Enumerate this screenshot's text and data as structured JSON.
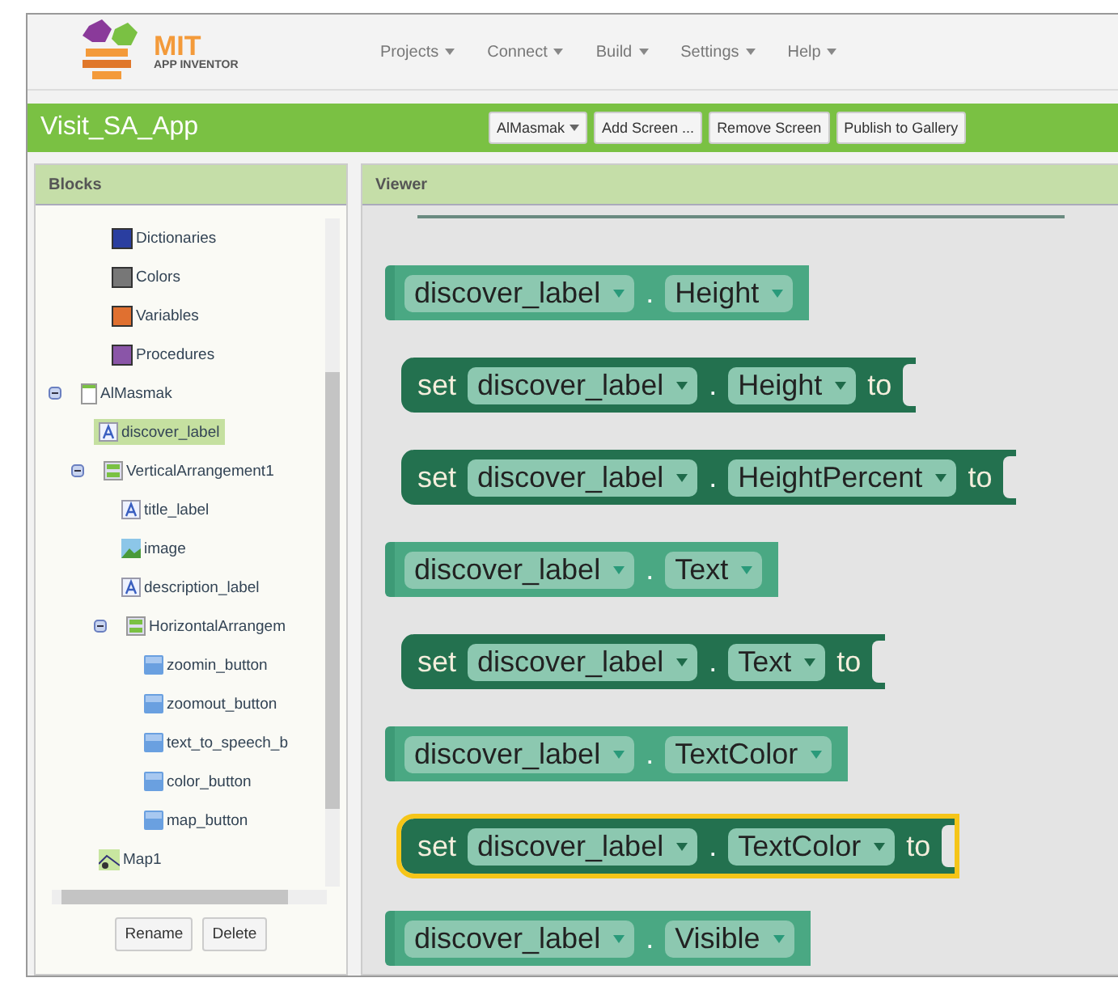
{
  "header": {
    "logo": {
      "title": "MIT",
      "subtitle": "APP INVENTOR"
    },
    "menus": [
      {
        "label": "Projects"
      },
      {
        "label": "Connect"
      },
      {
        "label": "Build"
      },
      {
        "label": "Settings"
      },
      {
        "label": "Help"
      }
    ]
  },
  "project_bar": {
    "title": "Visit_SA_App",
    "buttons": [
      {
        "label": "AlMasmak",
        "kind": "dropdown"
      },
      {
        "label": "Add Screen ...",
        "kind": "plain"
      },
      {
        "label": "Remove Screen",
        "kind": "plain"
      },
      {
        "label": "Publish to Gallery",
        "kind": "plain"
      }
    ]
  },
  "blocks_panel": {
    "title": "Blocks",
    "tree": [
      {
        "label": "Dictionaries",
        "kind": "category",
        "color": "#2a3ea0",
        "selected": false
      },
      {
        "label": "Colors",
        "kind": "category",
        "color": "#777777",
        "selected": false
      },
      {
        "label": "Variables",
        "kind": "category",
        "color": "#e07030",
        "selected": false
      },
      {
        "label": "Procedures",
        "kind": "category",
        "color": "#8a55a8",
        "selected": false
      },
      {
        "label": "AlMasmak",
        "kind": "screen",
        "expanded": true,
        "selected": false,
        "children": [
          {
            "label": "discover_label",
            "kind": "label",
            "selected": true
          },
          {
            "label": "VerticalArrangement1",
            "kind": "arrangement",
            "expanded": true,
            "selected": false,
            "children": [
              {
                "label": "title_label",
                "kind": "label",
                "selected": false
              },
              {
                "label": "image",
                "kind": "image",
                "selected": false
              },
              {
                "label": "description_label",
                "kind": "label",
                "selected": false
              },
              {
                "label": "HorizontalArrangem",
                "kind": "arrangement",
                "expanded": true,
                "selected": false,
                "children": [
                  {
                    "label": "zoomin_button",
                    "kind": "button",
                    "selected": false
                  },
                  {
                    "label": "zoomout_button",
                    "kind": "button",
                    "selected": false
                  },
                  {
                    "label": "text_to_speech_b",
                    "kind": "button",
                    "selected": false
                  },
                  {
                    "label": "color_button",
                    "kind": "button",
                    "selected": false
                  },
                  {
                    "label": "map_button",
                    "kind": "button",
                    "selected": false
                  }
                ]
              }
            ]
          },
          {
            "label": "Map1",
            "kind": "map",
            "selected": false
          }
        ]
      }
    ],
    "buttons": [
      "Rename",
      "Delete"
    ]
  },
  "viewer": {
    "title": "Viewer",
    "blocks": [
      {
        "kind": "get",
        "component": "discover_label",
        "separator": ".",
        "property": "Height",
        "selected": false
      },
      {
        "kind": "set",
        "keyword": "set",
        "component": "discover_label",
        "separator": ".",
        "property": "Height",
        "connector": "to",
        "selected": false
      },
      {
        "kind": "set",
        "keyword": "set",
        "component": "discover_label",
        "separator": ".",
        "property": "HeightPercent",
        "connector": "to",
        "selected": false
      },
      {
        "kind": "get",
        "component": "discover_label",
        "separator": ".",
        "property": "Text",
        "selected": false
      },
      {
        "kind": "set",
        "keyword": "set",
        "component": "discover_label",
        "separator": ".",
        "property": "Text",
        "connector": "to",
        "selected": false
      },
      {
        "kind": "get",
        "component": "discover_label",
        "separator": ".",
        "property": "TextColor",
        "selected": false
      },
      {
        "kind": "set",
        "keyword": "set",
        "component": "discover_label",
        "separator": ".",
        "property": "TextColor",
        "connector": "to",
        "selected": true
      },
      {
        "kind": "get",
        "component": "discover_label",
        "separator": ".",
        "property": "Visible",
        "selected": false
      }
    ]
  }
}
